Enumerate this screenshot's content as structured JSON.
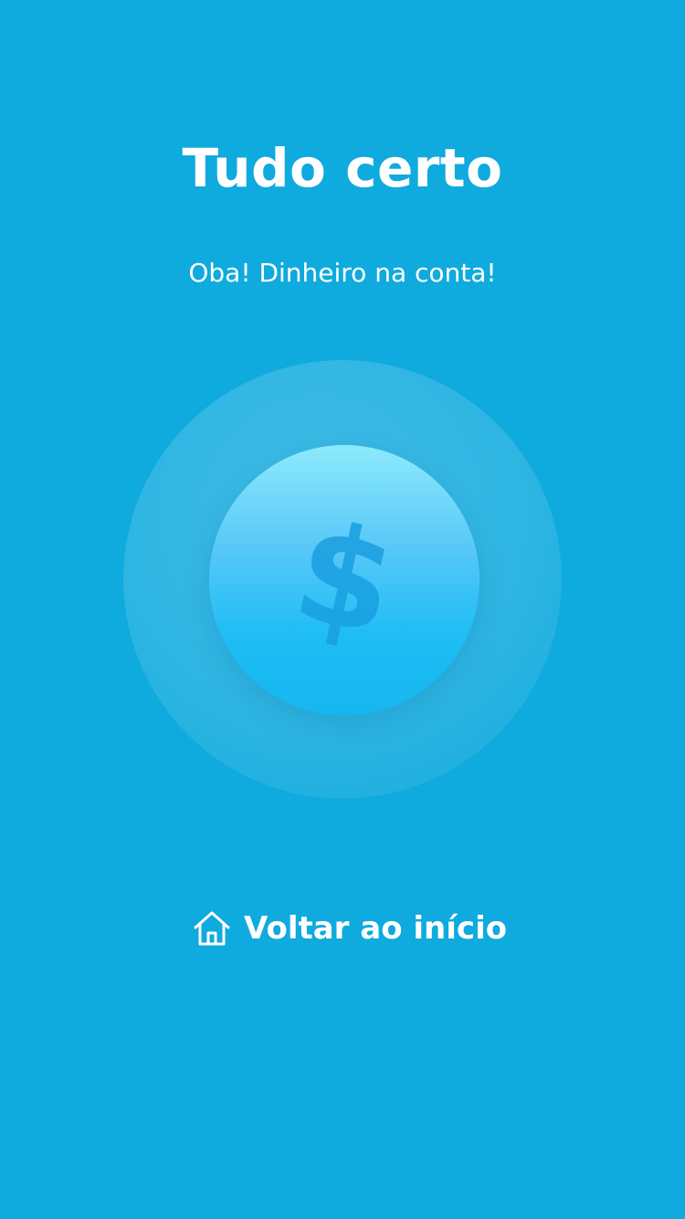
{
  "theme": {
    "background": "#0faade",
    "text": "#ffffff",
    "coin_top": "#8deafc",
    "coin_bottom": "#16b6f0",
    "dollar_color": "#1a9fe0"
  },
  "header": {
    "title": "Tudo certo",
    "subtitle": "Oba! Dinheiro na conta!"
  },
  "illustration": {
    "icon": "dollar-coin-icon",
    "symbol": "$"
  },
  "actions": {
    "home": {
      "icon": "home-icon",
      "label": "Voltar ao início"
    }
  }
}
